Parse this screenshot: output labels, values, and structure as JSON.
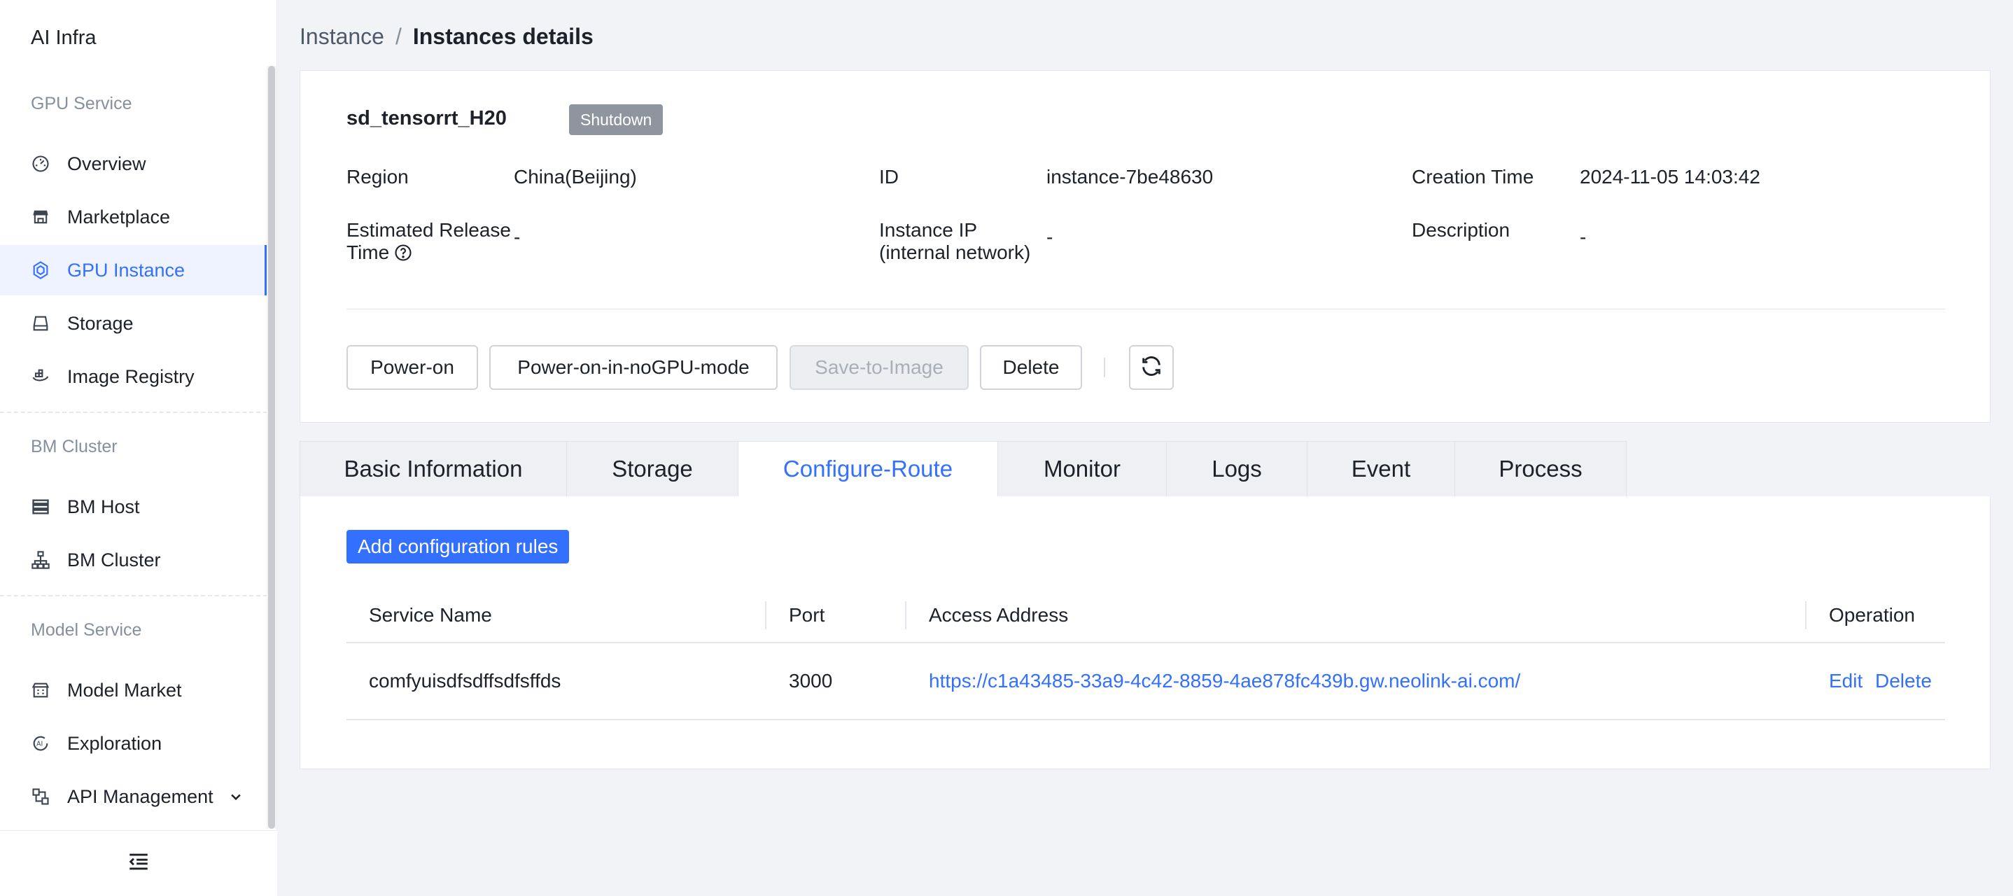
{
  "app": {
    "title": "AI Infra"
  },
  "sidebar": {
    "groups": [
      {
        "title": "GPU Service"
      },
      {
        "title": "BM Cluster"
      },
      {
        "title": "Model Service"
      }
    ],
    "items": [
      {
        "label": "Overview",
        "icon": "dashboard-icon"
      },
      {
        "label": "Marketplace",
        "icon": "store-icon"
      },
      {
        "label": "GPU Instance",
        "icon": "gpu-icon",
        "active": true
      },
      {
        "label": "Storage",
        "icon": "storage-icon"
      },
      {
        "label": "Image Registry",
        "icon": "registry-icon"
      },
      {
        "label": "BM Host",
        "icon": "server-icon"
      },
      {
        "label": "BM Cluster",
        "icon": "cluster-icon"
      },
      {
        "label": "Model Market",
        "icon": "model-market-icon"
      },
      {
        "label": "Exploration",
        "icon": "ai-icon"
      },
      {
        "label": "API Management",
        "icon": "api-icon",
        "expandable": true
      }
    ]
  },
  "breadcrumb": {
    "parent": "Instance",
    "separator": "/",
    "current": "Instances details"
  },
  "instance": {
    "name": "sd_tensorrt_H20",
    "status": "Shutdown",
    "fields": {
      "region_label": "Region",
      "region_value": "China(Beijing)",
      "id_label": "ID",
      "id_value": "instance-7be48630",
      "creation_label": "Creation Time",
      "creation_value": "2024-11-05 14:03:42",
      "release_label_line1": "Estimated Release",
      "release_label_line2": "Time",
      "release_value": "-",
      "ip_label_line1": "Instance IP",
      "ip_label_line2": "(internal network)",
      "ip_value": "-",
      "description_label": "Description",
      "description_value": "-"
    }
  },
  "actions": {
    "power_on": "Power-on",
    "power_on_nogpu": "Power-on-in-noGPU-mode",
    "save_to_image": "Save-to-Image",
    "delete": "Delete"
  },
  "tabs": [
    {
      "label": "Basic Information"
    },
    {
      "label": "Storage"
    },
    {
      "label": "Configure-Route",
      "active": true
    },
    {
      "label": "Monitor"
    },
    {
      "label": "Logs"
    },
    {
      "label": "Event"
    },
    {
      "label": "Process"
    }
  ],
  "route_panel": {
    "add_button": "Add configuration rules",
    "columns": [
      "Service Name",
      "Port",
      "Access Address",
      "Operation"
    ],
    "rows": [
      {
        "service_name": "comfyuisdfsdffsdfsffds",
        "port": "3000",
        "access_address": "https://c1a43485-33a9-4c42-8859-4ae878fc439b.gw.neolink-ai.com/",
        "edit": "Edit",
        "delete": "Delete"
      }
    ]
  },
  "colors": {
    "accent": "#3370ff",
    "status_badge": "#8f959e",
    "background": "#f2f3f7"
  }
}
